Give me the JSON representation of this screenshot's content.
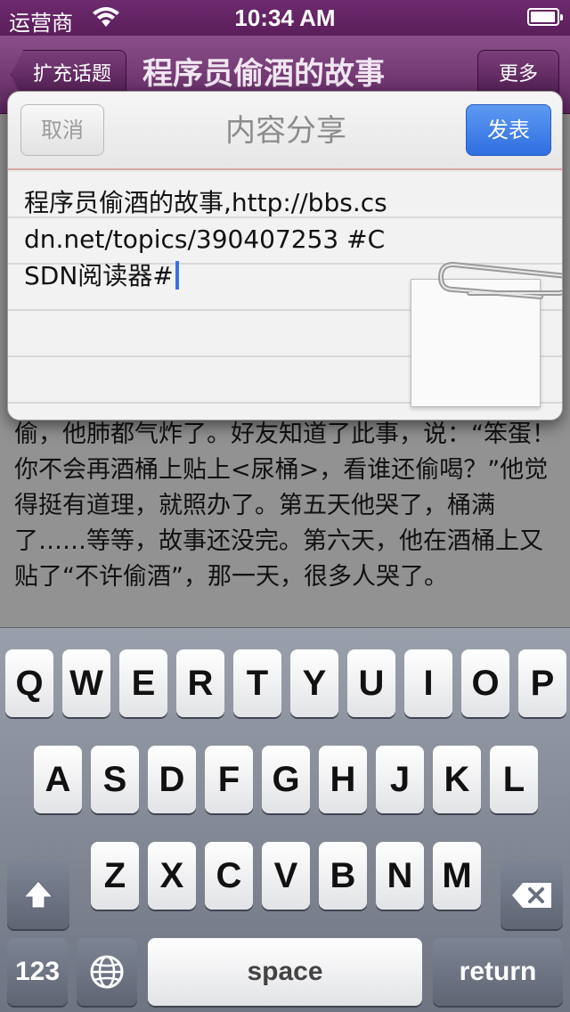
{
  "status_bar": {
    "carrier": "运营商",
    "time": "10:34 AM",
    "battery_level": 0.95
  },
  "nav_bar": {
    "back_label": "扩充话题",
    "title": "程序员偷酒的故事",
    "more_label": "更多"
  },
  "article": {
    "text": "偷，他肺都气炸了。好友知道了此事，说：“笨蛋！你不会再酒桶上贴上<尿桶>，看谁还偷喝？”他觉得挺有道理，就照办了。第五天他哭了，桶满了……等等，故事还没完。第六天，他在酒桶上又贴了“不许偷酒”，那一天，很多人哭了。"
  },
  "share_sheet": {
    "cancel_label": "取消",
    "title": "内容分享",
    "post_label": "发表",
    "text_value": "程序员偷酒的故事,http://bbs.csdn.net/topics/390407253  #CSDN阅读器#",
    "accent_color": "#3a75e6"
  },
  "keyboard": {
    "row1": [
      "Q",
      "W",
      "E",
      "R",
      "T",
      "Y",
      "U",
      "I",
      "O",
      "P"
    ],
    "row2": [
      "A",
      "S",
      "D",
      "F",
      "G",
      "H",
      "J",
      "K",
      "L"
    ],
    "row3": [
      "Z",
      "X",
      "C",
      "V",
      "B",
      "N",
      "M"
    ],
    "numbers_label": "123",
    "space_label": "space",
    "return_label": "return"
  }
}
